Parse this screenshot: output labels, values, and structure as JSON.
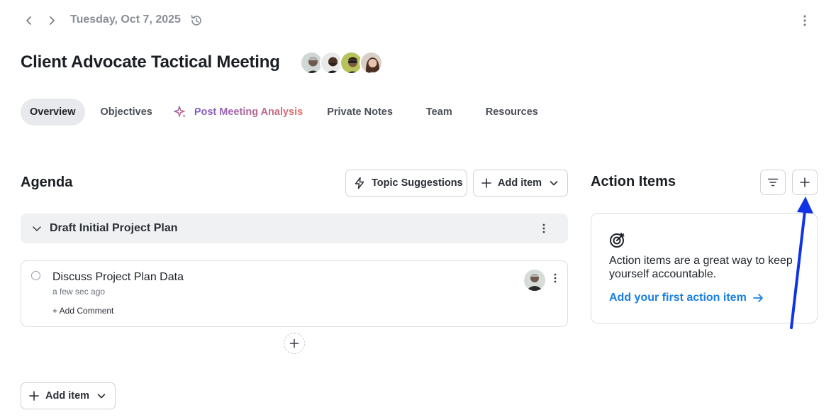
{
  "header": {
    "date": "Tuesday, Oct 7, 2025",
    "icons": [
      "chevron-left-icon",
      "chevron-right-icon",
      "history-icon",
      "more-vertical-icon"
    ]
  },
  "meeting": {
    "title": "Client Advocate Tactical Meeting",
    "attendee_count": 4
  },
  "tabs": [
    {
      "label": "Overview",
      "active": true
    },
    {
      "label": "Objectives",
      "active": false
    },
    {
      "label": "Post Meeting Analysis",
      "active": false,
      "icon": "sparkle-icon"
    },
    {
      "label": "Private Notes",
      "active": false
    },
    {
      "label": "Team",
      "active": false
    },
    {
      "label": "Resources",
      "active": false
    }
  ],
  "agenda": {
    "title": "Agenda",
    "topic_suggestions_label": "Topic Suggestions",
    "add_item_label": "Add item",
    "group": {
      "title": "Draft Initial Project Plan",
      "items": [
        {
          "title": "Discuss Project Plan Data",
          "time": "a few sec ago",
          "add_comment_label": "+ Add Comment"
        }
      ]
    },
    "bottom_add_item_label": "Add item"
  },
  "action_items": {
    "title": "Action Items",
    "empty_text": "Action items are a great way to keep yourself accountable.",
    "empty_link": "Add your first action item"
  },
  "colors": {
    "accent_link": "#1a7fe0",
    "annotation_arrow": "#1133e6",
    "ai_gradient_start": "#7c5cc4",
    "ai_gradient_end": "#e0716b"
  }
}
